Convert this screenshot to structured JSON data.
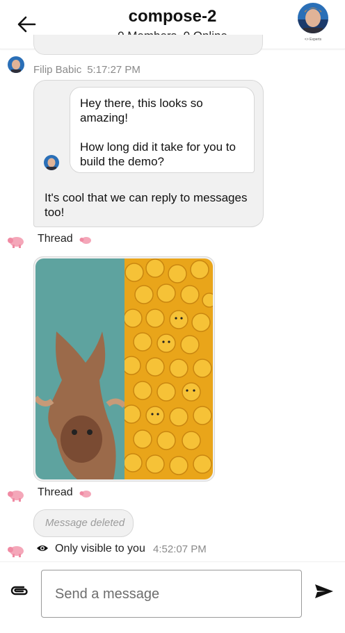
{
  "header": {
    "title": "compose-2",
    "subtitle": "0 Members, 0 Online"
  },
  "message": {
    "author": "Filip Babic",
    "time": "5:17:27 PM",
    "quote": "Hey there, this looks so amazing!\n\nHow long did it take for you to build the demo?",
    "reply": "It's cool that we can reply to messages too!"
  },
  "thread_label": "Thread",
  "deleted_message": "Message deleted",
  "visibility": {
    "text": "Only visible to you",
    "time": "4:52:07 PM"
  },
  "composer": {
    "placeholder": "Send a message"
  },
  "icons": {
    "back": "arrow-left-icon",
    "attach": "paperclip-icon",
    "send": "send-icon",
    "visibility": "eye-icon",
    "pig": "pig-emoji-icon"
  },
  "colors": {
    "bubble_bg": "#f1f1f1",
    "bubble_border": "#d6d6d6",
    "meta_text": "#8a8a8a",
    "giraffe_bg": "#5ea39f",
    "lego_bg": "#e9a51a"
  }
}
